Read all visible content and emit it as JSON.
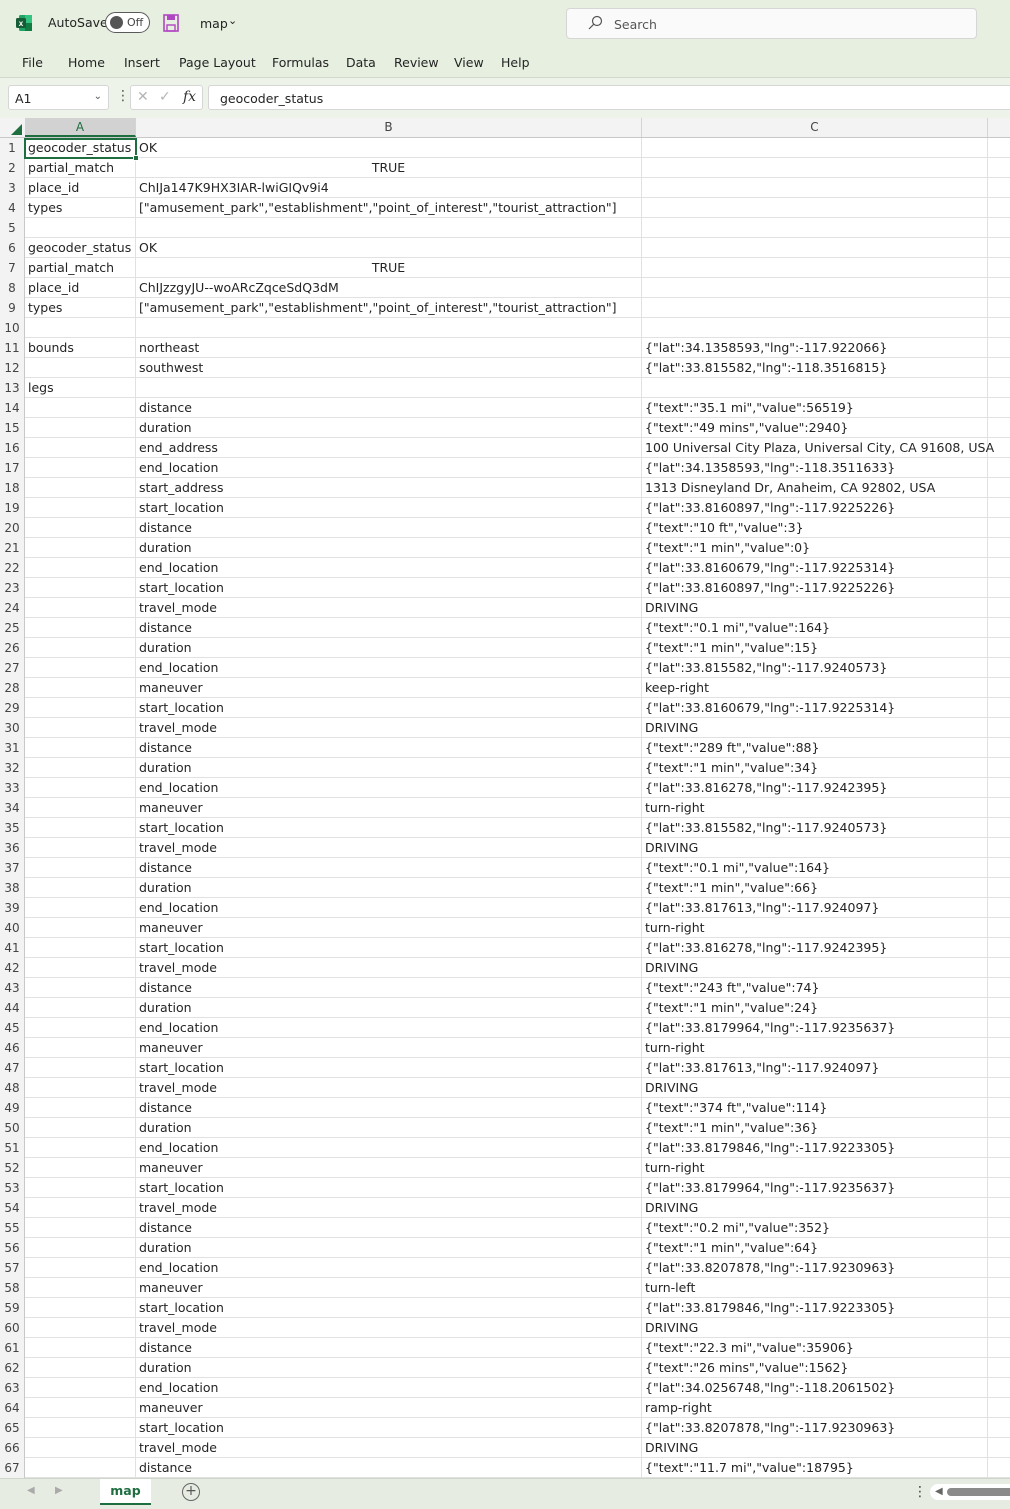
{
  "titlebar": {
    "autosave_label": "AutoSave",
    "autosave_state": "Off",
    "file_name": "map",
    "search_placeholder": "Search"
  },
  "menu": [
    "File",
    "Home",
    "Insert",
    "Page Layout",
    "Formulas",
    "Data",
    "Review",
    "View",
    "Help"
  ],
  "formula_bar": {
    "name_box": "A1",
    "formula": "geocoder_status"
  },
  "columns": [
    "A",
    "B",
    "C"
  ],
  "selected_cell": "A1",
  "rows": [
    {
      "n": "1",
      "a": "geocoder_status",
      "b": "OK",
      "c": ""
    },
    {
      "n": "2",
      "a": "partial_match",
      "b": "TRUE",
      "c": "",
      "b_center": true
    },
    {
      "n": "3",
      "a": "place_id",
      "b": "ChIJa147K9HX3IAR-lwiGIQv9i4",
      "c": ""
    },
    {
      "n": "4",
      "a": "types",
      "b": "[\"amusement_park\",\"establishment\",\"point_of_interest\",\"tourist_attraction\"]",
      "c": ""
    },
    {
      "n": "5",
      "a": "",
      "b": "",
      "c": ""
    },
    {
      "n": "6",
      "a": "geocoder_status",
      "b": "OK",
      "c": ""
    },
    {
      "n": "7",
      "a": "partial_match",
      "b": "TRUE",
      "c": "",
      "b_center": true
    },
    {
      "n": "8",
      "a": "place_id",
      "b": "ChIJzzgyJU--woARcZqceSdQ3dM",
      "c": ""
    },
    {
      "n": "9",
      "a": "types",
      "b": "[\"amusement_park\",\"establishment\",\"point_of_interest\",\"tourist_attraction\"]",
      "c": ""
    },
    {
      "n": "10",
      "a": "",
      "b": "",
      "c": ""
    },
    {
      "n": "11",
      "a": "bounds",
      "b": "northeast",
      "c": "{\"lat\":34.1358593,\"lng\":-117.922066}"
    },
    {
      "n": "12",
      "a": "",
      "b": "southwest",
      "c": "{\"lat\":33.815582,\"lng\":-118.3516815}"
    },
    {
      "n": "13",
      "a": "legs",
      "b": "",
      "c": ""
    },
    {
      "n": "14",
      "a": "",
      "b": "distance",
      "c": "{\"text\":\"35.1 mi\",\"value\":56519}"
    },
    {
      "n": "15",
      "a": "",
      "b": "duration",
      "c": "{\"text\":\"49 mins\",\"value\":2940}"
    },
    {
      "n": "16",
      "a": "",
      "b": "end_address",
      "c": "100 Universal City Plaza, Universal City, CA 91608, USA"
    },
    {
      "n": "17",
      "a": "",
      "b": "end_location",
      "c": "{\"lat\":34.1358593,\"lng\":-118.3511633}"
    },
    {
      "n": "18",
      "a": "",
      "b": "start_address",
      "c": "1313 Disneyland Dr, Anaheim, CA 92802, USA"
    },
    {
      "n": "19",
      "a": "",
      "b": "start_location",
      "c": "{\"lat\":33.8160897,\"lng\":-117.9225226}"
    },
    {
      "n": "20",
      "a": "",
      "b": "distance",
      "c": "{\"text\":\"10 ft\",\"value\":3}"
    },
    {
      "n": "21",
      "a": "",
      "b": "duration",
      "c": "{\"text\":\"1 min\",\"value\":0}"
    },
    {
      "n": "22",
      "a": "",
      "b": "end_location",
      "c": "{\"lat\":33.8160679,\"lng\":-117.9225314}"
    },
    {
      "n": "23",
      "a": "",
      "b": "start_location",
      "c": "{\"lat\":33.8160897,\"lng\":-117.9225226}"
    },
    {
      "n": "24",
      "a": "",
      "b": "travel_mode",
      "c": "DRIVING"
    },
    {
      "n": "25",
      "a": "",
      "b": "distance",
      "c": "{\"text\":\"0.1 mi\",\"value\":164}"
    },
    {
      "n": "26",
      "a": "",
      "b": "duration",
      "c": "{\"text\":\"1 min\",\"value\":15}"
    },
    {
      "n": "27",
      "a": "",
      "b": "end_location",
      "c": "{\"lat\":33.815582,\"lng\":-117.9240573}"
    },
    {
      "n": "28",
      "a": "",
      "b": "maneuver",
      "c": "keep-right"
    },
    {
      "n": "29",
      "a": "",
      "b": "start_location",
      "c": "{\"lat\":33.8160679,\"lng\":-117.9225314}"
    },
    {
      "n": "30",
      "a": "",
      "b": "travel_mode",
      "c": "DRIVING"
    },
    {
      "n": "31",
      "a": "",
      "b": "distance",
      "c": "{\"text\":\"289 ft\",\"value\":88}"
    },
    {
      "n": "32",
      "a": "",
      "b": "duration",
      "c": "{\"text\":\"1 min\",\"value\":34}"
    },
    {
      "n": "33",
      "a": "",
      "b": "end_location",
      "c": "{\"lat\":33.816278,\"lng\":-117.9242395}"
    },
    {
      "n": "34",
      "a": "",
      "b": "maneuver",
      "c": "turn-right"
    },
    {
      "n": "35",
      "a": "",
      "b": "start_location",
      "c": "{\"lat\":33.815582,\"lng\":-117.9240573}"
    },
    {
      "n": "36",
      "a": "",
      "b": "travel_mode",
      "c": "DRIVING"
    },
    {
      "n": "37",
      "a": "",
      "b": "distance",
      "c": "{\"text\":\"0.1 mi\",\"value\":164}"
    },
    {
      "n": "38",
      "a": "",
      "b": "duration",
      "c": "{\"text\":\"1 min\",\"value\":66}"
    },
    {
      "n": "39",
      "a": "",
      "b": "end_location",
      "c": "{\"lat\":33.817613,\"lng\":-117.924097}"
    },
    {
      "n": "40",
      "a": "",
      "b": "maneuver",
      "c": "turn-right"
    },
    {
      "n": "41",
      "a": "",
      "b": "start_location",
      "c": "{\"lat\":33.816278,\"lng\":-117.9242395}"
    },
    {
      "n": "42",
      "a": "",
      "b": "travel_mode",
      "c": "DRIVING"
    },
    {
      "n": "43",
      "a": "",
      "b": "distance",
      "c": "{\"text\":\"243 ft\",\"value\":74}"
    },
    {
      "n": "44",
      "a": "",
      "b": "duration",
      "c": "{\"text\":\"1 min\",\"value\":24}"
    },
    {
      "n": "45",
      "a": "",
      "b": "end_location",
      "c": "{\"lat\":33.8179964,\"lng\":-117.9235637}"
    },
    {
      "n": "46",
      "a": "",
      "b": "maneuver",
      "c": "turn-right"
    },
    {
      "n": "47",
      "a": "",
      "b": "start_location",
      "c": "{\"lat\":33.817613,\"lng\":-117.924097}"
    },
    {
      "n": "48",
      "a": "",
      "b": "travel_mode",
      "c": "DRIVING"
    },
    {
      "n": "49",
      "a": "",
      "b": "distance",
      "c": "{\"text\":\"374 ft\",\"value\":114}"
    },
    {
      "n": "50",
      "a": "",
      "b": "duration",
      "c": "{\"text\":\"1 min\",\"value\":36}"
    },
    {
      "n": "51",
      "a": "",
      "b": "end_location",
      "c": "{\"lat\":33.8179846,\"lng\":-117.9223305}"
    },
    {
      "n": "52",
      "a": "",
      "b": "maneuver",
      "c": "turn-right"
    },
    {
      "n": "53",
      "a": "",
      "b": "start_location",
      "c": "{\"lat\":33.8179964,\"lng\":-117.9235637}"
    },
    {
      "n": "54",
      "a": "",
      "b": "travel_mode",
      "c": "DRIVING"
    },
    {
      "n": "55",
      "a": "",
      "b": "distance",
      "c": "{\"text\":\"0.2 mi\",\"value\":352}"
    },
    {
      "n": "56",
      "a": "",
      "b": "duration",
      "c": "{\"text\":\"1 min\",\"value\":64}"
    },
    {
      "n": "57",
      "a": "",
      "b": "end_location",
      "c": "{\"lat\":33.8207878,\"lng\":-117.9230963}"
    },
    {
      "n": "58",
      "a": "",
      "b": "maneuver",
      "c": "turn-left"
    },
    {
      "n": "59",
      "a": "",
      "b": "start_location",
      "c": "{\"lat\":33.8179846,\"lng\":-117.9223305}"
    },
    {
      "n": "60",
      "a": "",
      "b": "travel_mode",
      "c": "DRIVING"
    },
    {
      "n": "61",
      "a": "",
      "b": "distance",
      "c": "{\"text\":\"22.3 mi\",\"value\":35906}"
    },
    {
      "n": "62",
      "a": "",
      "b": "duration",
      "c": "{\"text\":\"26 mins\",\"value\":1562}"
    },
    {
      "n": "63",
      "a": "",
      "b": "end_location",
      "c": "{\"lat\":34.0256748,\"lng\":-118.2061502}"
    },
    {
      "n": "64",
      "a": "",
      "b": "maneuver",
      "c": "ramp-right"
    },
    {
      "n": "65",
      "a": "",
      "b": "start_location",
      "c": "{\"lat\":33.8207878,\"lng\":-117.9230963}"
    },
    {
      "n": "66",
      "a": "",
      "b": "travel_mode",
      "c": "DRIVING"
    },
    {
      "n": "67",
      "a": "",
      "b": "distance",
      "c": "{\"text\":\"11.7 mi\",\"value\":18795}"
    }
  ],
  "sheets": {
    "tabs": [
      "map"
    ],
    "active": "map",
    "add_sheet_icon": "plus-circle-icon"
  },
  "colors": {
    "accent": "#1e6e40",
    "chrome_bg": "#e6efe0",
    "save_icon": "#b146c2"
  }
}
